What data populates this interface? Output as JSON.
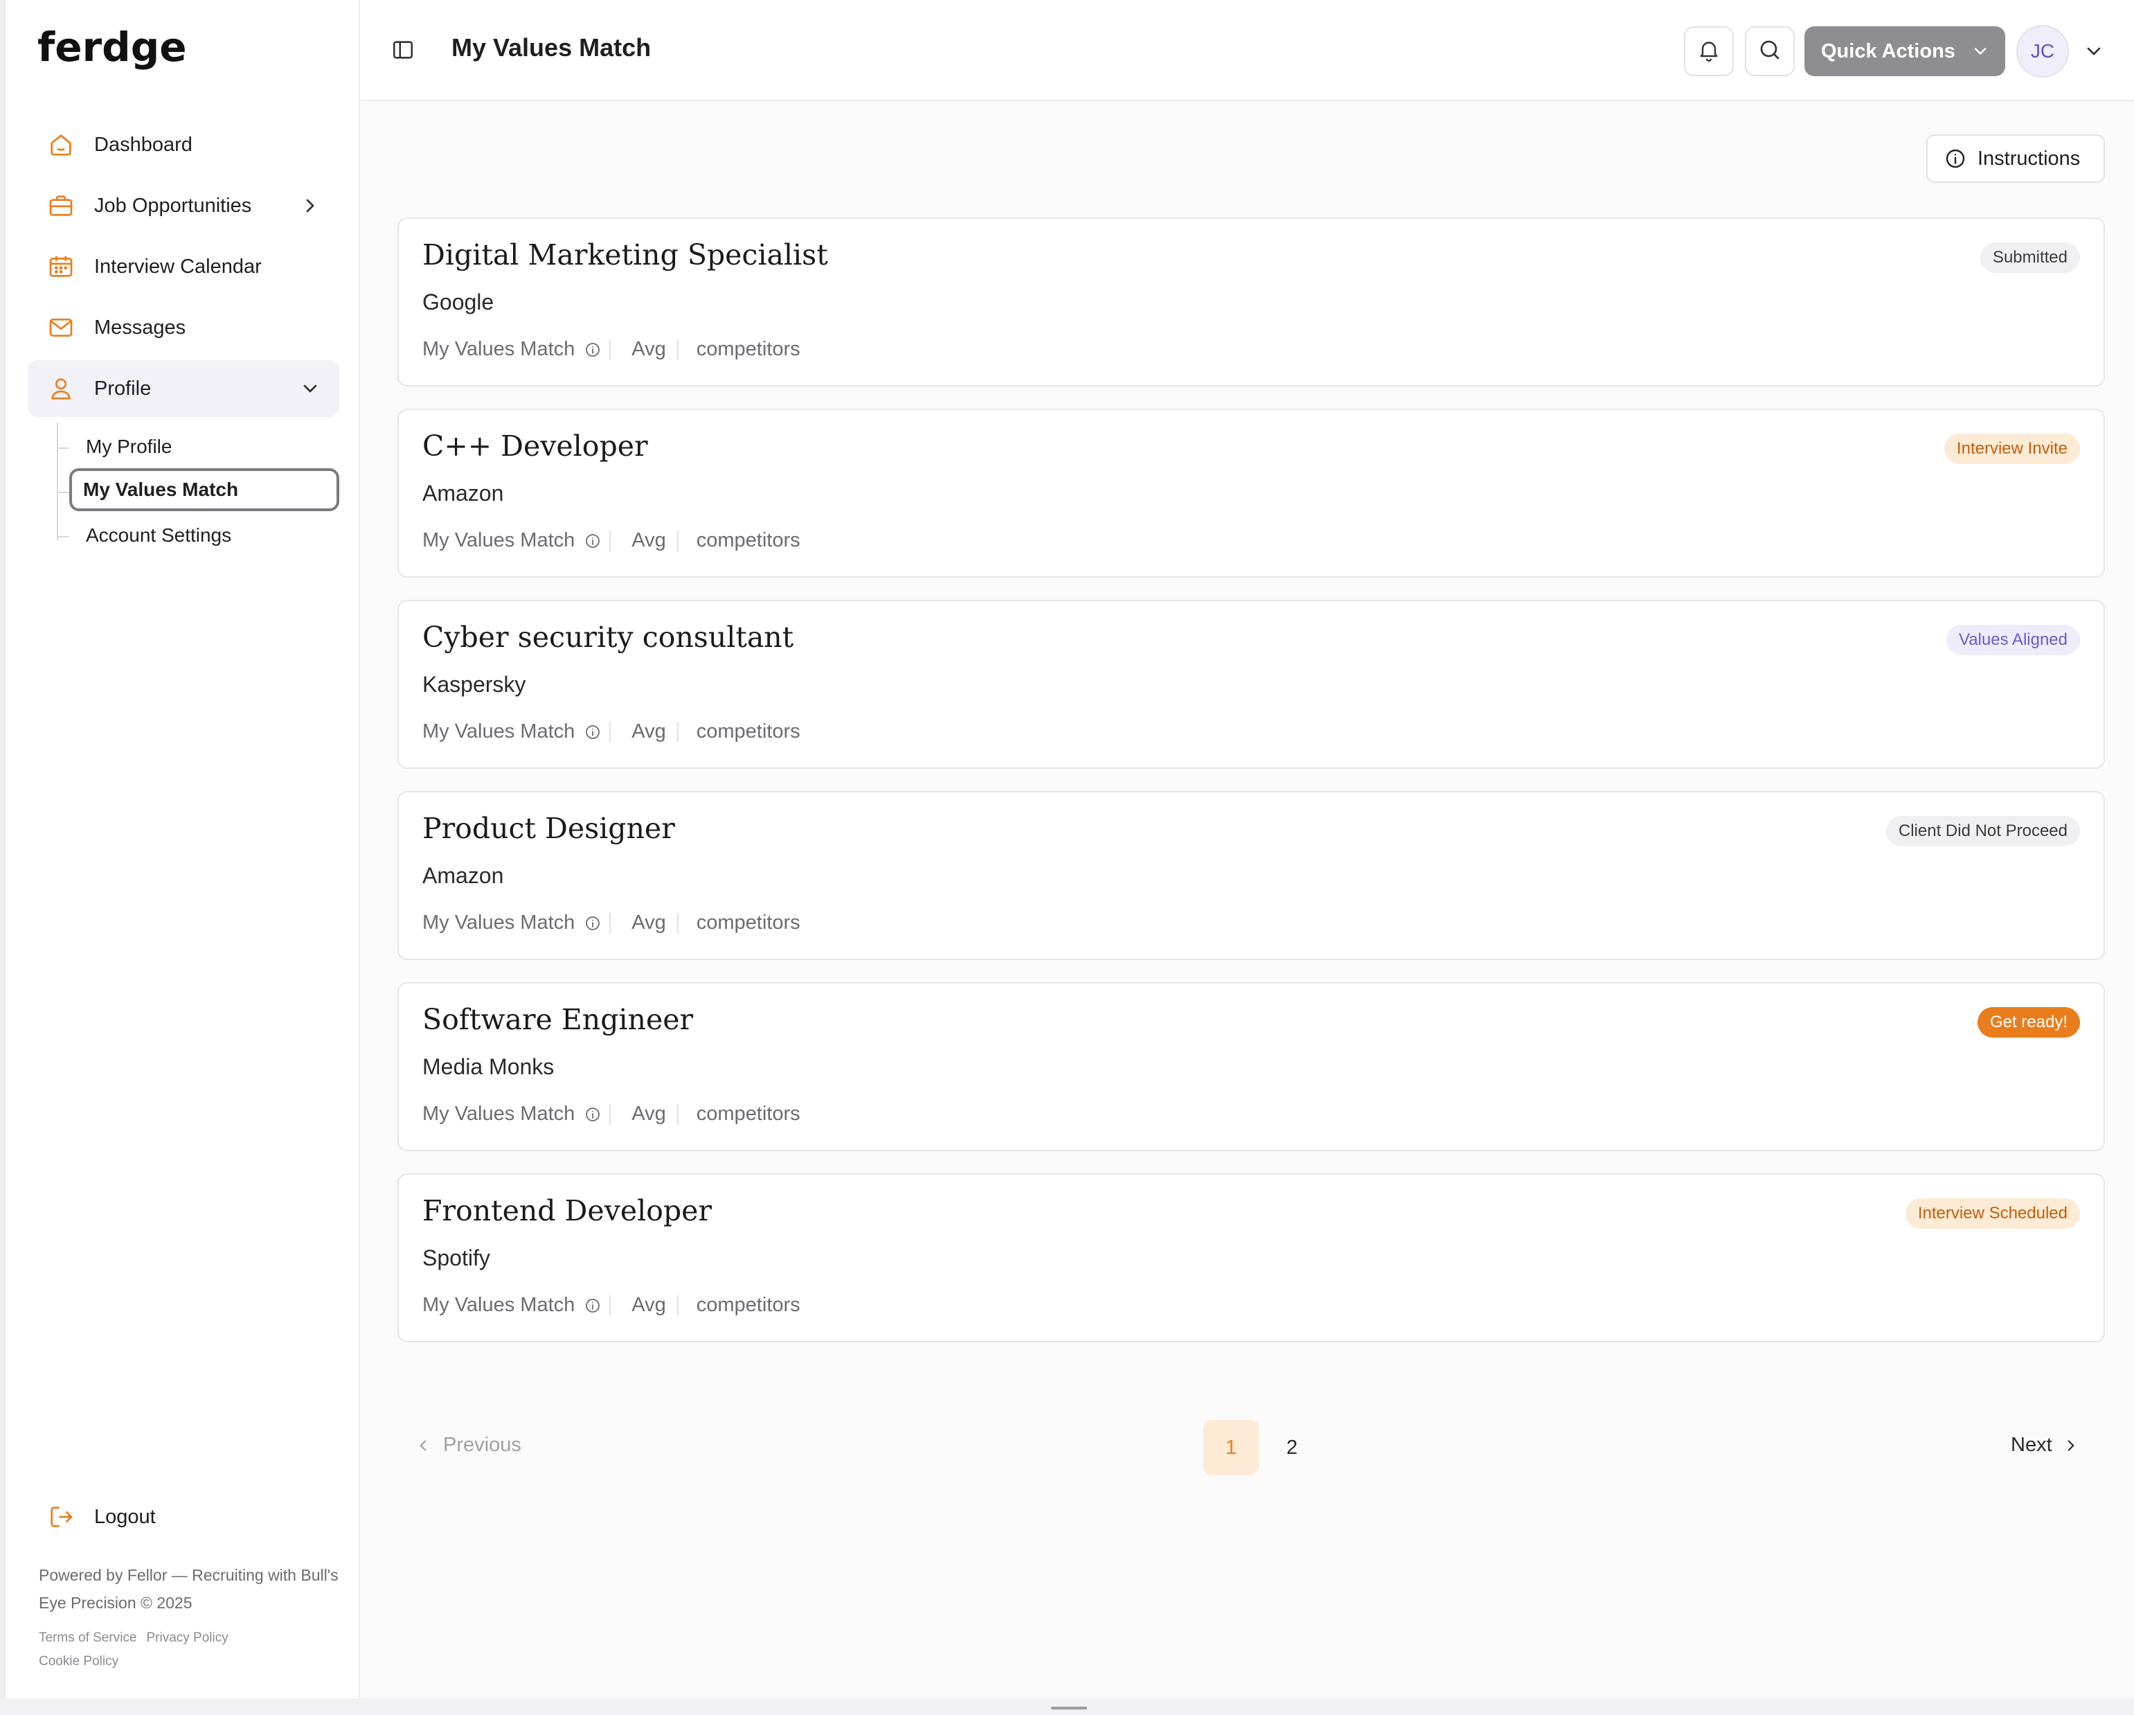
{
  "app": {
    "brand": "ferdge"
  },
  "colors": {
    "accent": "#ea7d1b",
    "quick_actions_bg": "#8e8e92",
    "avatar_text": "#5b52c7"
  },
  "sidebar": {
    "items": [
      {
        "label": "Dashboard",
        "icon": "home-icon"
      },
      {
        "label": "Job Opportunities",
        "icon": "briefcase-icon"
      },
      {
        "label": "Interview Calendar",
        "icon": "calendar-icon"
      },
      {
        "label": "Messages",
        "icon": "mail-icon"
      },
      {
        "label": "Profile",
        "icon": "user-icon"
      }
    ],
    "profile_sub": [
      "My Profile",
      "My Values Match",
      "Account Settings"
    ],
    "logout": "Logout",
    "powered_by": "Powered by Fellor — Recruiting with Bull's Eye Precision © 2025",
    "legal": {
      "terms": "Terms of Service",
      "privacy": "Privacy Policy",
      "cookie": "Cookie Policy"
    }
  },
  "header": {
    "title": "My Values Match",
    "quick_actions": "Quick Actions",
    "avatar_initials": "JC"
  },
  "main": {
    "instructions_label": "Instructions",
    "cards": [
      {
        "title": "Digital Marketing Specialist",
        "company": "Google",
        "badge": "Submitted",
        "badge_style": "gray"
      },
      {
        "title": "C++ Developer",
        "company": "Amazon",
        "badge": "Interview Invite",
        "badge_style": "peach"
      },
      {
        "title": "Cyber security consultant",
        "company": "Kaspersky",
        "badge": "Values Aligned",
        "badge_style": "purple"
      },
      {
        "title": "Product Designer",
        "company": "Amazon",
        "badge": "Client Did Not Proceed",
        "badge_style": "gray"
      },
      {
        "title": "Software Engineer",
        "company": "Media Monks",
        "badge": "Get ready!",
        "badge_style": "orange"
      },
      {
        "title": "Frontend Developer",
        "company": "Spotify",
        "badge": "Interview Scheduled",
        "badge_style": "peach"
      }
    ],
    "meta": {
      "label": "My Values Match",
      "avg": "Avg",
      "competitors": "competitors"
    },
    "pagination": {
      "previous": "Previous",
      "next": "Next",
      "pages": [
        "1",
        "2"
      ],
      "current": "1"
    }
  }
}
